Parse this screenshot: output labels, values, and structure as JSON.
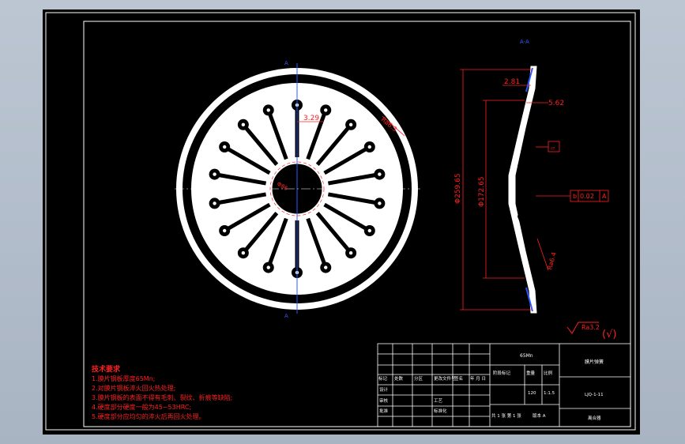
{
  "drawing": {
    "section_label": "A-A",
    "cut_marker": "A",
    "dimensions": {
      "hole_pitch": "3.29",
      "bore": "Φ86",
      "roughness_face": "Ra6.3",
      "sec_small": "2.81",
      "sec_thick": "5.62",
      "outer_dia": "Φ259.65",
      "inner_dia": "Φ172.65",
      "roughness_edge": "Ra6.4",
      "flatness_symbol": "▱",
      "tolerance_symbol": "b",
      "tolerance_value": "0.02",
      "tolerance_ref": "A",
      "roughness_general": "Ra3.2",
      "roughness_check": "(√)"
    },
    "notes": {
      "title": "技术要求",
      "items": [
        "1.膜片钢板厚度65Mn;",
        "2.对膜片钢板淬火回火热处理;",
        "3.膜片钢板的表面不得有毛刺、裂纹、折痕等缺陷;",
        "4.硬度部分硬度一般为45~53HRC;",
        "5.硬度部分应均匀的淬火后再回火处理。"
      ]
    },
    "title_block": {
      "material": "65Mn",
      "part_name": "膜片弹簧",
      "drawing_no": "LJQ-1-11",
      "unit": "离合器",
      "scale_header": "比例",
      "scale": "1:1.5",
      "weight_header": "重量",
      "stage_header": "阶段标记",
      "sheets": "共 1 张  第 1 张",
      "version": "版本 A",
      "qty": "120",
      "header_cols": [
        "标记",
        "处数",
        "分区",
        "更改文件号",
        "签名",
        "年 月 日"
      ],
      "rows": [
        "设计",
        "审核",
        "工艺",
        "批准",
        "标准化"
      ]
    }
  }
}
